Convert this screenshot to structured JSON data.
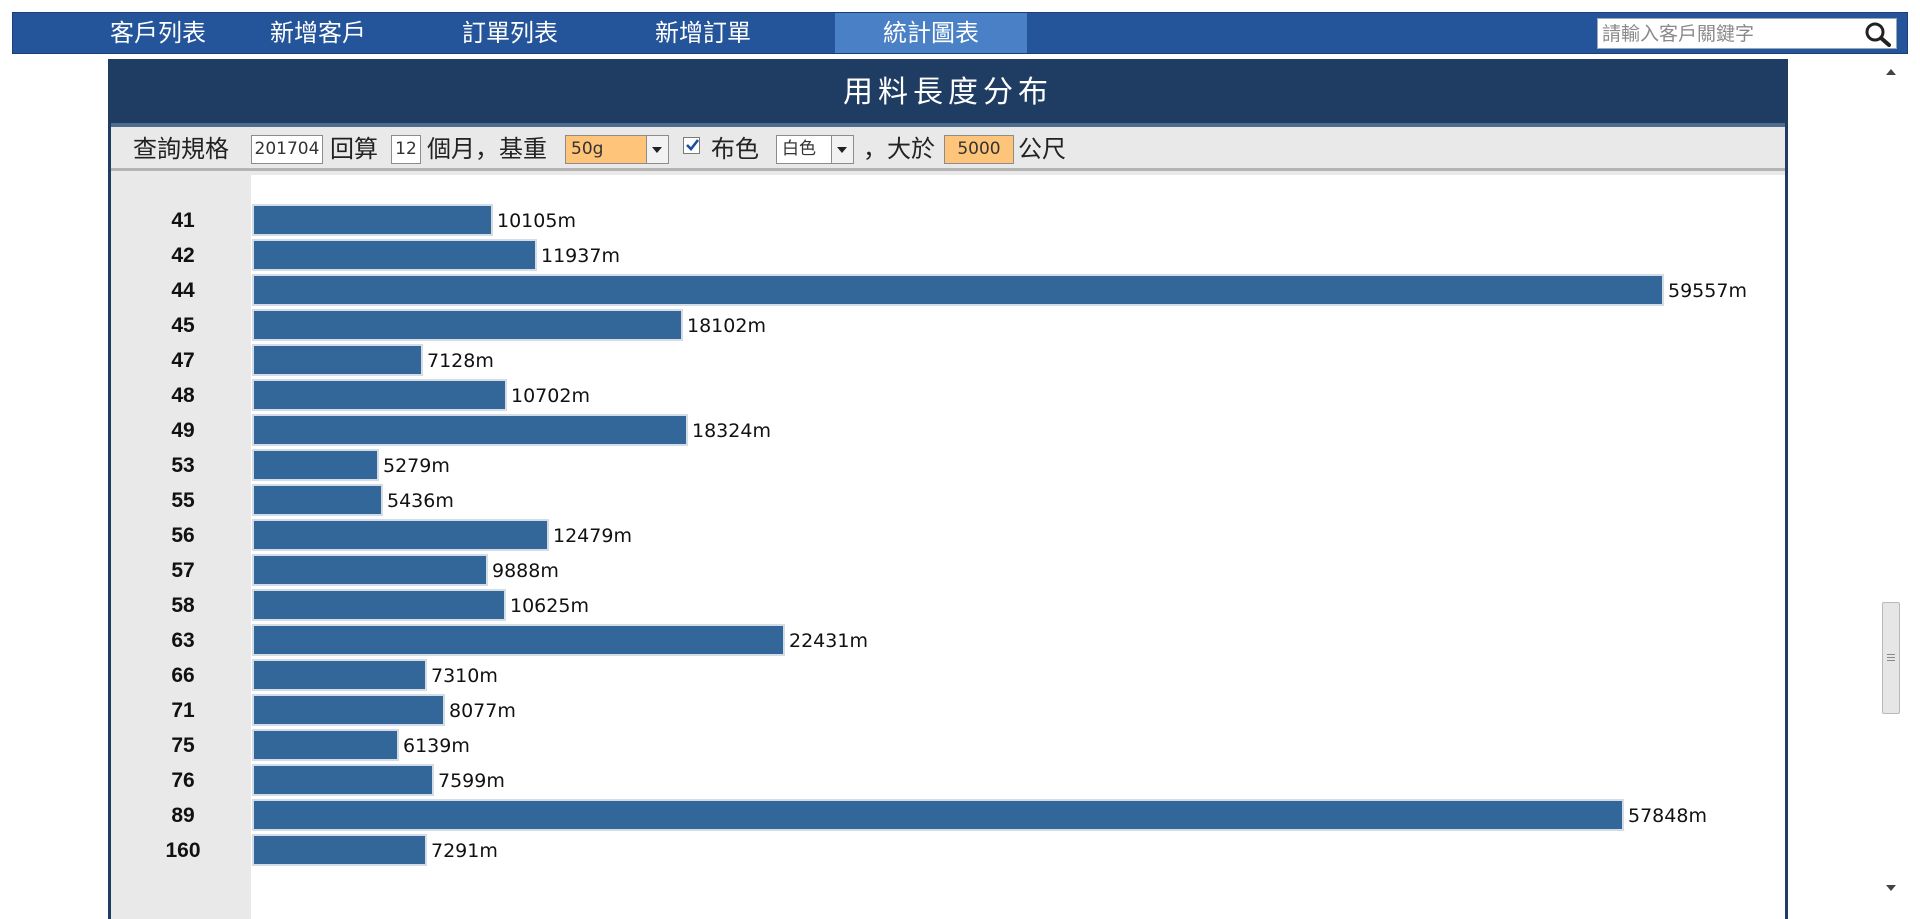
{
  "nav": {
    "items": [
      {
        "label": "客戶列表",
        "active": false
      },
      {
        "label": "新增客戶",
        "active": false
      },
      {
        "label": "訂單列表",
        "active": false
      },
      {
        "label": "新增訂單",
        "active": false
      },
      {
        "label": "統計圖表",
        "active": true
      }
    ],
    "search_placeholder": "請輸入客戶關鍵字",
    "search_icon": "search-icon"
  },
  "panel": {
    "title": "用料長度分布"
  },
  "filter": {
    "label": "查詢規格",
    "start_month": "201704",
    "back_label": "回算",
    "months": "12",
    "months_suffix": "個月，基重",
    "basis_weight": "50g",
    "color_label": "布色",
    "color_checked": true,
    "color_value": "白色",
    "greater_label": "，大於",
    "min_length": "5000",
    "unit_label": "公尺"
  },
  "colors": {
    "nav_bg": "#24549a",
    "nav_active": "#4a80c6",
    "title_bg": "#1f3d62",
    "bar": "#336699",
    "input_highlight": "#fdc47a"
  },
  "chart_data": {
    "type": "bar",
    "orientation": "horizontal",
    "categories": [
      "41",
      "42",
      "44",
      "45",
      "47",
      "48",
      "49",
      "53",
      "55",
      "56",
      "57",
      "58",
      "63",
      "66",
      "71",
      "75",
      "76",
      "89",
      "160"
    ],
    "values": [
      10105,
      11937,
      59557,
      18102,
      7128,
      10702,
      18324,
      5279,
      5436,
      12479,
      9888,
      10625,
      22431,
      7310,
      8077,
      6139,
      7599,
      57848,
      7291
    ],
    "value_suffix": "m",
    "xlim": [
      0,
      59557
    ]
  }
}
